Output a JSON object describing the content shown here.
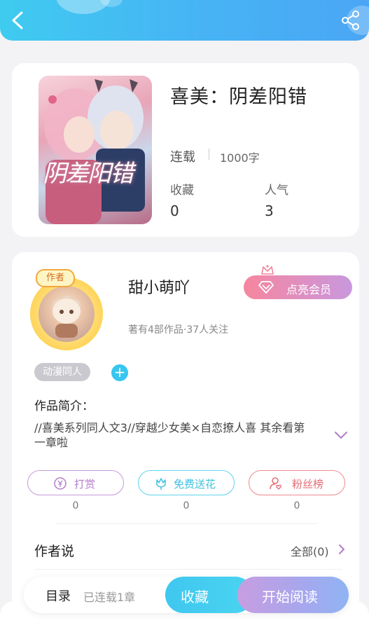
{
  "header": {
    "back_icon": "chevron-left-icon",
    "share_icon": "share-icon",
    "accent": "#47b3f4"
  },
  "book": {
    "cover_text": "阴差阳错",
    "title": "喜美：阴差阳错",
    "status": "连载",
    "word_count": "1000字",
    "favorites_label": "收藏",
    "favorites_value": "0",
    "popularity_label": "人气",
    "popularity_value": "3"
  },
  "author": {
    "avatar_tag": "作者",
    "name": "甜小萌吖",
    "vip_label": "点亮会员",
    "meta": "著有4部作品·37人关注",
    "tag": "动漫同人",
    "tag_add": "+"
  },
  "intro": {
    "title": "作品简介：",
    "text": "//喜美系列同人文3//穿越少女美×自恋撩人喜 其余看第一章啦"
  },
  "actions": [
    {
      "label": "打赏",
      "count": "0",
      "icon": "yen-coin-icon",
      "color": "#b47dcb"
    },
    {
      "label": "免费送花",
      "count": "0",
      "icon": "flower-icon",
      "color": "#3ec2df"
    },
    {
      "label": "粉丝榜",
      "count": "0",
      "icon": "user-heart-icon",
      "color": "#e46c75"
    }
  ],
  "author_says": {
    "title": "作者说",
    "all_label": "全部(0)"
  },
  "bottom_bar": {
    "toc_label": "目录",
    "toc_status": "已连载1章",
    "collect_label": "收藏",
    "read_label": "开始阅读"
  }
}
